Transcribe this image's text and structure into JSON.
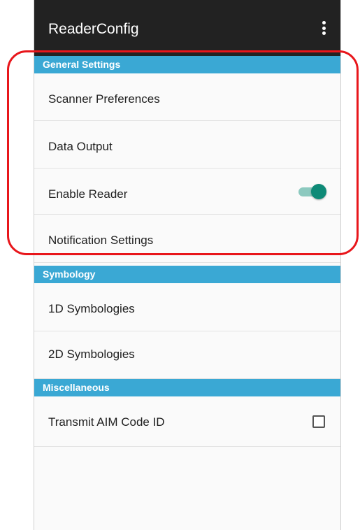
{
  "app": {
    "title": "ReaderConfig"
  },
  "sections": {
    "general": {
      "header": "General Settings",
      "items": {
        "scanner_preferences": "Scanner Preferences",
        "data_output": "Data Output",
        "enable_reader": "Enable Reader",
        "notification_settings": "Notification Settings"
      }
    },
    "symbology": {
      "header": "Symbology",
      "items": {
        "symbologies_1d": "1D Symbologies",
        "symbologies_2d": "2D Symbologies"
      }
    },
    "misc": {
      "header": "Miscellaneous",
      "items": {
        "transmit_aim": "Transmit AIM Code ID"
      }
    }
  },
  "state": {
    "enable_reader_on": true,
    "transmit_aim_checked": false
  },
  "icons": {
    "overflow_menu": "more-vert-icon"
  },
  "colors": {
    "appbar": "#222222",
    "section_header": "#3aa8d4",
    "toggle_accent": "#0e8a77",
    "highlight": "#e8161b"
  }
}
